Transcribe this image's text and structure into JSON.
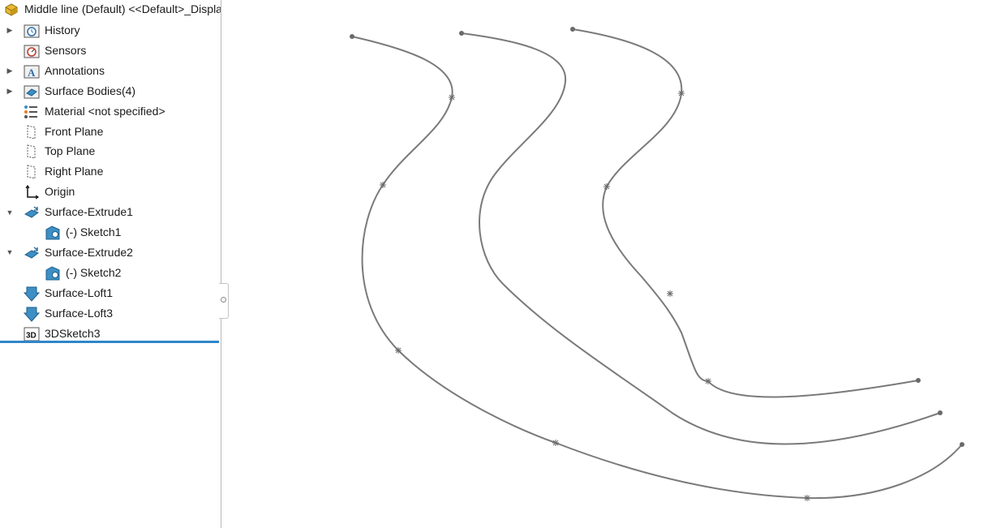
{
  "tree": {
    "root": {
      "label": "Middle line (Default) <<Default>_Display",
      "icon": "part-icon"
    },
    "items": [
      {
        "label": "History",
        "icon": "history-folder-icon",
        "expandable": true,
        "expanded": false,
        "level": 0
      },
      {
        "label": "Sensors",
        "icon": "sensors-icon",
        "expandable": false,
        "level": 0
      },
      {
        "label": "Annotations",
        "icon": "annotations-icon",
        "expandable": true,
        "expanded": false,
        "level": 0
      },
      {
        "label": "Surface Bodies(4)",
        "icon": "surface-bodies-icon",
        "expandable": true,
        "expanded": false,
        "level": 0
      },
      {
        "label": "Material <not specified>",
        "icon": "material-icon",
        "expandable": false,
        "level": 0
      },
      {
        "label": "Front Plane",
        "icon": "plane-icon",
        "expandable": false,
        "level": 0
      },
      {
        "label": "Top Plane",
        "icon": "plane-icon",
        "expandable": false,
        "level": 0
      },
      {
        "label": "Right Plane",
        "icon": "plane-icon",
        "expandable": false,
        "level": 0
      },
      {
        "label": "Origin",
        "icon": "origin-icon",
        "expandable": false,
        "level": 0
      },
      {
        "label": "Surface-Extrude1",
        "icon": "surface-extrude-icon",
        "expandable": true,
        "expanded": true,
        "level": 0
      },
      {
        "label": "(-) Sketch1",
        "icon": "sketch-icon",
        "expandable": false,
        "level": 1
      },
      {
        "label": "Surface-Extrude2",
        "icon": "surface-extrude-icon",
        "expandable": true,
        "expanded": true,
        "level": 0
      },
      {
        "label": "(-) Sketch2",
        "icon": "sketch-icon",
        "expandable": false,
        "level": 1
      },
      {
        "label": "Surface-Loft1",
        "icon": "surface-loft-icon",
        "expandable": false,
        "level": 0
      },
      {
        "label": "Surface-Loft3",
        "icon": "surface-loft-icon",
        "expandable": false,
        "level": 0
      },
      {
        "label": "3DSketch3",
        "icon": "3dsketch-icon",
        "expandable": false,
        "level": 0
      }
    ]
  },
  "viewport": {
    "curve_color": "#7a7a7a",
    "curves": [
      "outer-curve",
      "middle-curve",
      "inner-curve"
    ]
  },
  "colors": {
    "rollback_bar": "#2f86c8",
    "feature_blue": "#3d8fc4"
  }
}
